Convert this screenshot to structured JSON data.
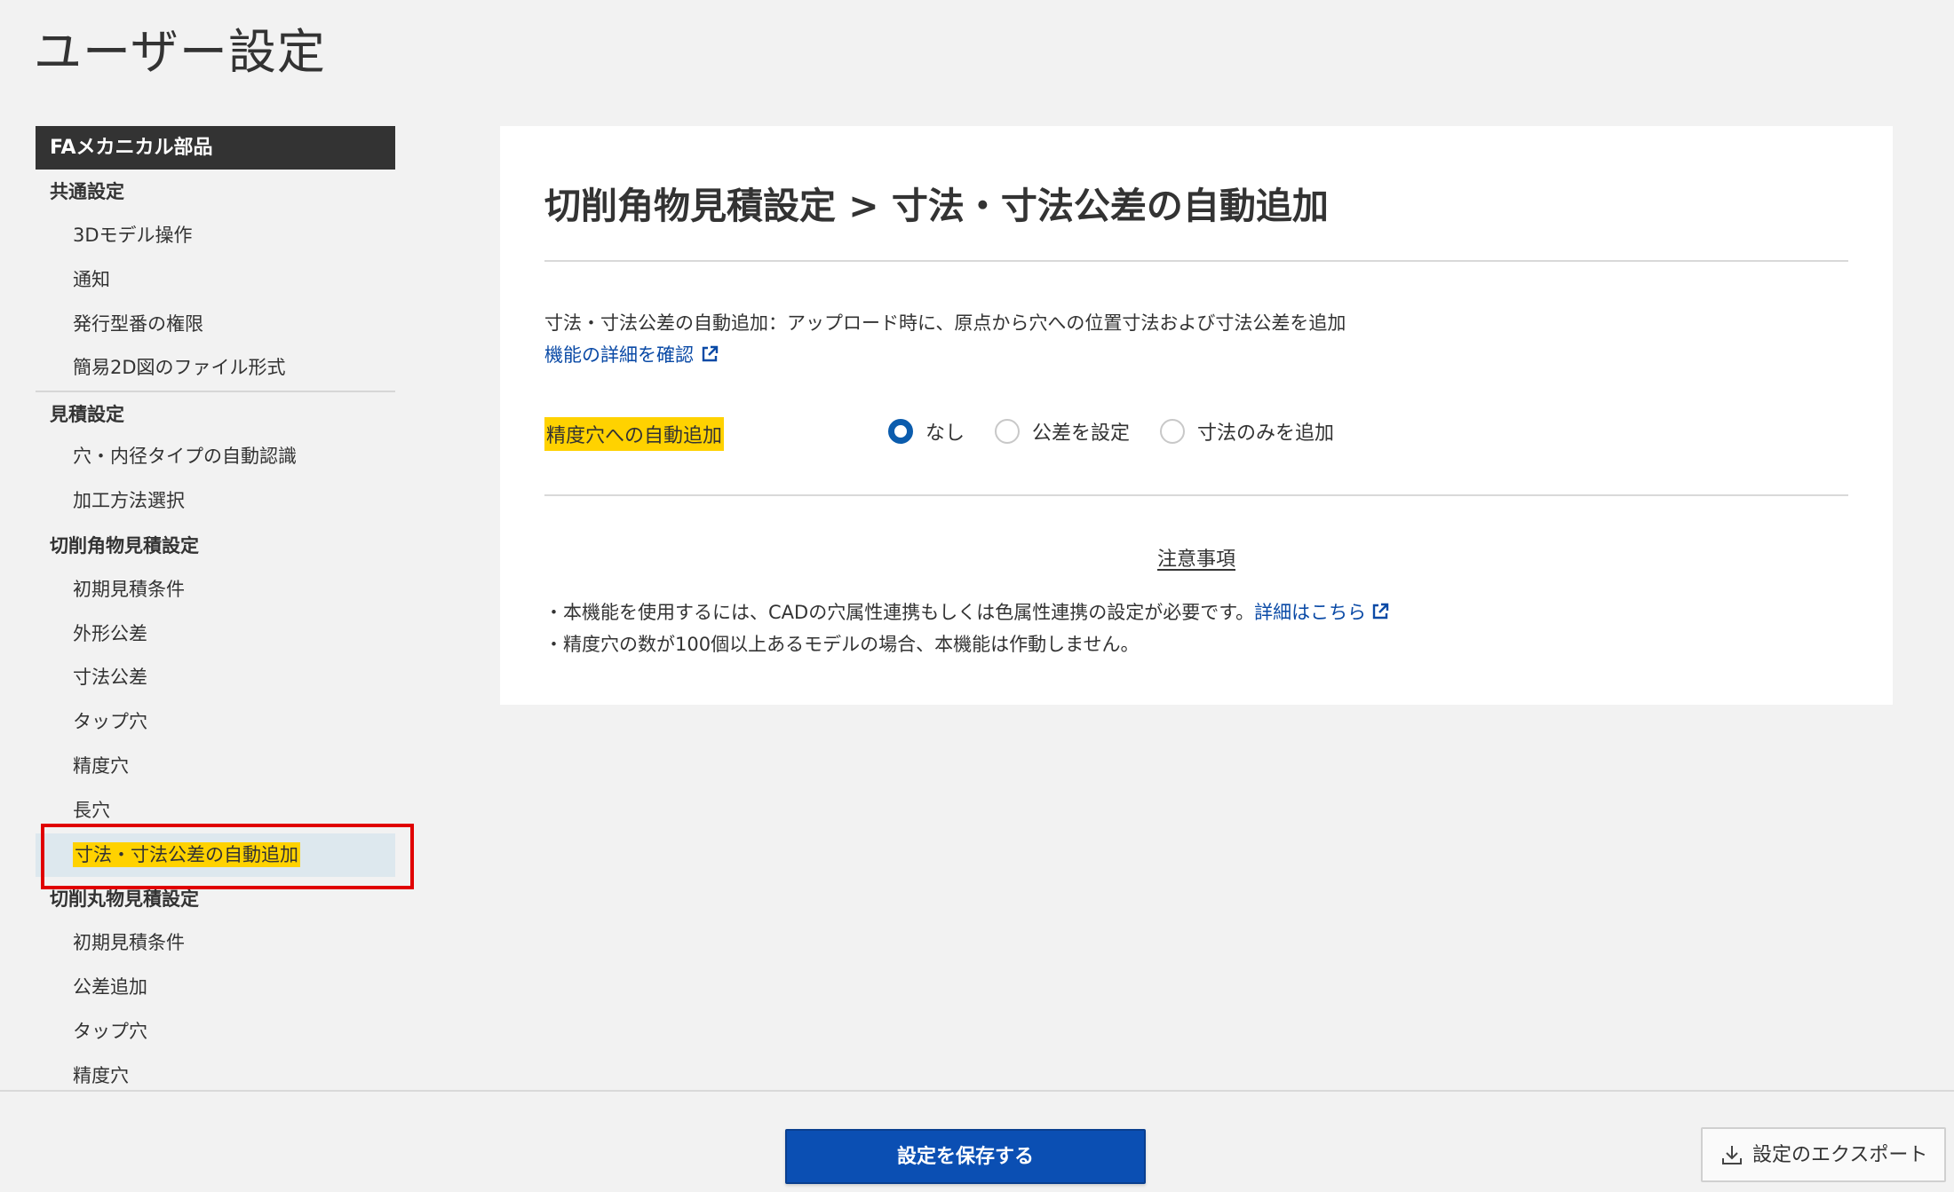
{
  "page": {
    "title": "ユーザー設定"
  },
  "sidebar": {
    "header": "FAメカニカル部品",
    "sections": [
      {
        "title": "共通設定",
        "items": [
          "3Dモデル操作",
          "通知",
          "発行型番の権限",
          "簡易2D図のファイル形式"
        ]
      },
      {
        "title": "見積設定",
        "items": [
          "穴・内径タイプの自動認識",
          "加工方法選択"
        ]
      },
      {
        "title": "切削角物見積設定",
        "items": [
          "初期見積条件",
          "外形公差",
          "寸法公差",
          "タップ穴",
          "精度穴",
          "長穴",
          "寸法・寸法公差の自動追加"
        ]
      },
      {
        "title": "切削丸物見積設定",
        "items": [
          "初期見積条件",
          "公差追加",
          "タップ穴",
          "精度穴"
        ]
      }
    ],
    "active_item": "寸法・寸法公差の自動追加"
  },
  "main": {
    "title": "切削角物見積設定 > 寸法・寸法公差の自動追加",
    "description": "寸法・寸法公差の自動追加：アップロード時に、原点から穴への位置寸法および寸法公差を追加",
    "detail_link": "機能の詳細を確認",
    "field_label": "精度穴への自動追加",
    "radio_options": [
      "なし",
      "公差を設定",
      "寸法のみを追加"
    ],
    "radio_selected": "なし",
    "notes_title": "注意事項",
    "note1_text": "・本機能を使用するには、CADの穴属性連携もしくは色属性連携の設定が必要です。",
    "note1_link": "詳細はこちら",
    "note2_text": "・精度穴の数が100個以上あるモデルの場合、本機能は作動しません。"
  },
  "footer": {
    "save_label": "設定を保存する",
    "export_label": "設定のエクスポート"
  },
  "colors": {
    "accent": "#0b4fb3",
    "link": "#0a4aa6",
    "highlight": "#ffd200",
    "active_bg": "#dde8ee",
    "callout_border": "#e00000",
    "sidebar_header_bg": "#333333"
  },
  "icons": [
    "external-link-icon",
    "download-icon",
    "radio-selected",
    "radio-unselected"
  ]
}
